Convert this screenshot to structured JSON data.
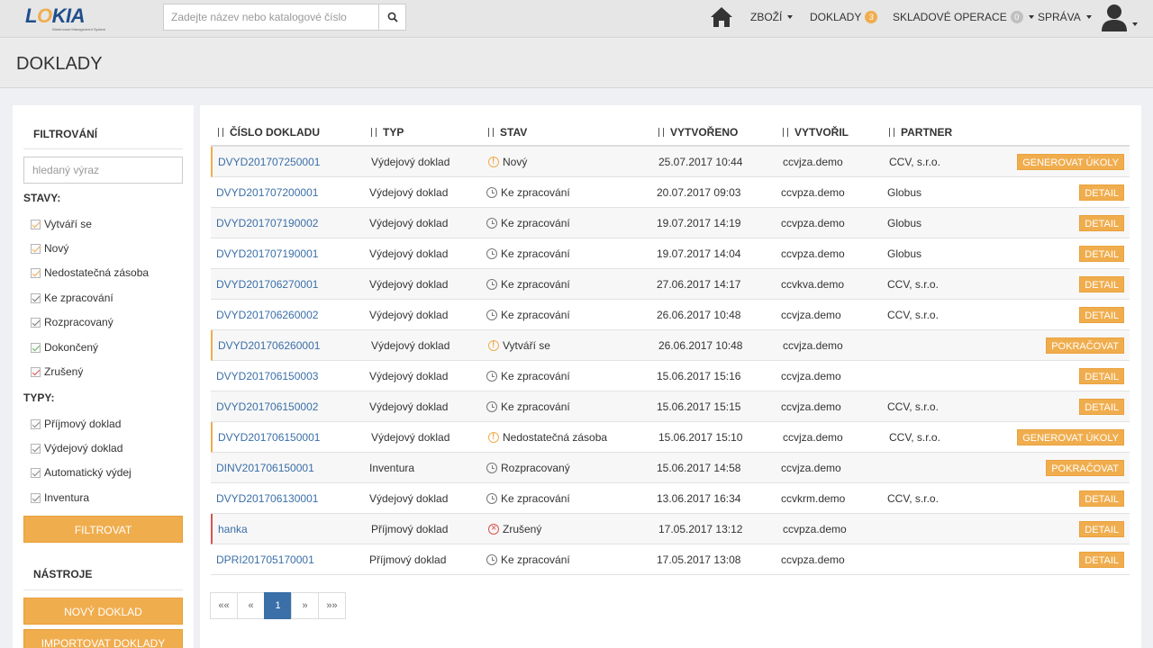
{
  "app": {
    "logo_text": "LOKIA",
    "logo_subtitle": "Warehouse Management System"
  },
  "search": {
    "placeholder": "Zadejte název nebo katalogové číslo",
    "value": ""
  },
  "nav": {
    "items": [
      {
        "label": "ZBOŽÍ",
        "has_caret": true,
        "badge": null
      },
      {
        "label": "DOKLADY",
        "has_caret": false,
        "badge": "3"
      },
      {
        "label": "SKLADOVÉ OPERACE",
        "has_caret": true,
        "badge": "0"
      },
      {
        "label": "SPRÁVA",
        "has_caret": true,
        "badge": null
      }
    ]
  },
  "page": {
    "title": "DOKLADY"
  },
  "sidebar": {
    "filter_heading": "FILTROVÁNÍ",
    "filter_placeholder": "hledaný výraz",
    "states_label": "STAVY:",
    "states": [
      {
        "label": "Vytváří se",
        "checked": true,
        "color": "orange"
      },
      {
        "label": "Nový",
        "checked": true,
        "color": "orange"
      },
      {
        "label": "Nedostatečná zásoba",
        "checked": true,
        "color": "orange"
      },
      {
        "label": "Ke zpracování",
        "checked": true,
        "color": "gray"
      },
      {
        "label": "Rozpracovaný",
        "checked": true,
        "color": "gray"
      },
      {
        "label": "Dokončený",
        "checked": true,
        "color": "green"
      },
      {
        "label": "Zrušený",
        "checked": true,
        "color": "red"
      }
    ],
    "types_label": "TYPY:",
    "types": [
      {
        "label": "Příjmový doklad",
        "checked": true
      },
      {
        "label": "Výdejový doklad",
        "checked": true
      },
      {
        "label": "Automatický výdej",
        "checked": true
      },
      {
        "label": "Inventura",
        "checked": true
      }
    ],
    "filter_button": "FILTROVAT",
    "tools_heading": "NÁSTROJE",
    "new_doc_button": "NOVÝ DOKLAD",
    "import_button": "IMPORTOVAT DOKLADY"
  },
  "table": {
    "columns": [
      "ČÍSLO DOKLADU",
      "TYP",
      "STAV",
      "VYTVOŘENO",
      "VYTVOŘIL",
      "PARTNER"
    ],
    "rows": [
      {
        "number": "DVYD201707250001",
        "type": "Výdejový doklad",
        "state": "Nový",
        "state_icon": "warn",
        "created": "25.07.2017 10:44",
        "author": "ccvjza.demo",
        "partner": "CCV, s.r.o.",
        "action": "GENEROVAT ÚKOLY",
        "highlight": "warn"
      },
      {
        "number": "DVYD201707200001",
        "type": "Výdejový doklad",
        "state": "Ke zpracování",
        "state_icon": "clock",
        "created": "20.07.2017 09:03",
        "author": "ccvpza.demo",
        "partner": "Globus",
        "action": "DETAIL",
        "highlight": ""
      },
      {
        "number": "DVYD201707190002",
        "type": "Výdejový doklad",
        "state": "Ke zpracování",
        "state_icon": "clock",
        "created": "19.07.2017 14:19",
        "author": "ccvpza.demo",
        "partner": "Globus",
        "action": "DETAIL",
        "highlight": ""
      },
      {
        "number": "DVYD201707190001",
        "type": "Výdejový doklad",
        "state": "Ke zpracování",
        "state_icon": "clock",
        "created": "19.07.2017 14:04",
        "author": "ccvpza.demo",
        "partner": "Globus",
        "action": "DETAIL",
        "highlight": ""
      },
      {
        "number": "DVYD201706270001",
        "type": "Výdejový doklad",
        "state": "Ke zpracování",
        "state_icon": "clock",
        "created": "27.06.2017 14:17",
        "author": "ccvkva.demo",
        "partner": "CCV, s.r.o.",
        "action": "DETAIL",
        "highlight": ""
      },
      {
        "number": "DVYD201706260002",
        "type": "Výdejový doklad",
        "state": "Ke zpracování",
        "state_icon": "clock",
        "created": "26.06.2017 10:48",
        "author": "ccvjza.demo",
        "partner": "CCV, s.r.o.",
        "action": "DETAIL",
        "highlight": ""
      },
      {
        "number": "DVYD201706260001",
        "type": "Výdejový doklad",
        "state": "Vytváří se",
        "state_icon": "warn",
        "created": "26.06.2017 10:48",
        "author": "ccvjza.demo",
        "partner": "",
        "action": "POKRAČOVAT",
        "highlight": "warn"
      },
      {
        "number": "DVYD201706150003",
        "type": "Výdejový doklad",
        "state": "Ke zpracování",
        "state_icon": "clock",
        "created": "15.06.2017 15:16",
        "author": "ccvjza.demo",
        "partner": "",
        "action": "DETAIL",
        "highlight": ""
      },
      {
        "number": "DVYD201706150002",
        "type": "Výdejový doklad",
        "state": "Ke zpracování",
        "state_icon": "clock",
        "created": "15.06.2017 15:15",
        "author": "ccvjza.demo",
        "partner": "CCV, s.r.o.",
        "action": "DETAIL",
        "highlight": ""
      },
      {
        "number": "DVYD201706150001",
        "type": "Výdejový doklad",
        "state": "Nedostatečná zásoba",
        "state_icon": "warn",
        "created": "15.06.2017 15:10",
        "author": "ccvjza.demo",
        "partner": "CCV, s.r.o.",
        "action": "GENEROVAT ÚKOLY",
        "highlight": "warn"
      },
      {
        "number": "DINV201706150001",
        "type": "Inventura",
        "state": "Rozpracovaný",
        "state_icon": "clock",
        "created": "15.06.2017 14:58",
        "author": "ccvjza.demo",
        "partner": "",
        "action": "POKRAČOVAT",
        "highlight": ""
      },
      {
        "number": "DVYD201706130001",
        "type": "Výdejový doklad",
        "state": "Ke zpracování",
        "state_icon": "clock",
        "created": "13.06.2017 16:34",
        "author": "ccvkrm.demo",
        "partner": "CCV, s.r.o.",
        "action": "DETAIL",
        "highlight": ""
      },
      {
        "number": "hanka",
        "type": "Příjmový doklad",
        "state": "Zrušený",
        "state_icon": "cancel",
        "created": "17.05.2017 13:12",
        "author": "ccvpza.demo",
        "partner": "",
        "action": "DETAIL",
        "highlight": "danger"
      },
      {
        "number": "DPRI201705170001",
        "type": "Příjmový doklad",
        "state": "Ke zpracování",
        "state_icon": "clock",
        "created": "17.05.2017 13:08",
        "author": "ccvpza.demo",
        "partner": "",
        "action": "DETAIL",
        "highlight": ""
      }
    ]
  },
  "pagination": {
    "first": "««",
    "prev": "«",
    "current": "1",
    "next": "»",
    "last": "»»"
  },
  "colors": {
    "accent": "#f0ad4e",
    "link": "#3a6fa8",
    "danger": "#d9534f",
    "success": "#5cb85c"
  }
}
